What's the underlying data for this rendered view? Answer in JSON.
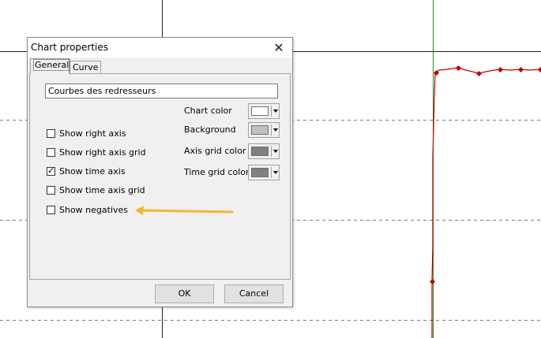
{
  "dialog": {
    "title": "Chart properties",
    "close_glyph": "✕",
    "tabs": [
      {
        "label": "General",
        "active": true
      },
      {
        "label": "Curve",
        "active": false
      }
    ],
    "chart_name": "Courbes des redresseurs",
    "checkboxes": [
      {
        "label": "Show right axis",
        "checked": false
      },
      {
        "label": "Show right axis grid",
        "checked": false
      },
      {
        "label": "Show time axis",
        "checked": true
      },
      {
        "label": "Show time axis grid",
        "checked": false
      },
      {
        "label": "Show negatives",
        "checked": false
      }
    ],
    "colors": [
      {
        "label": "Chart color",
        "value": "#ffffff"
      },
      {
        "label": "Background",
        "value": "#c0c0c0"
      },
      {
        "label": "Axis grid color",
        "value": "#808080"
      },
      {
        "label": "Time grid color",
        "value": "#808080"
      }
    ],
    "buttons": {
      "ok": "OK",
      "cancel": "Cancel"
    }
  },
  "annotation": {
    "color": "#f2b632",
    "icon": "arrow-left-icon"
  },
  "background_chart": {
    "line_color": "#c00000",
    "axis_color": "#2a8a2a",
    "grid_color": "#7a7a7a"
  }
}
